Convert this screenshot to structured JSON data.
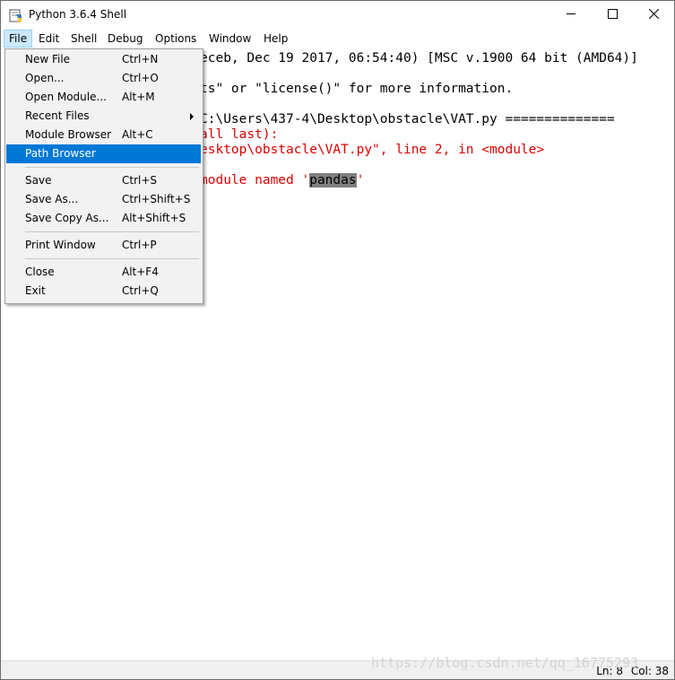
{
  "window": {
    "title": "Python 3.6.4 Shell"
  },
  "menubar": [
    {
      "label": "File"
    },
    {
      "label": "Edit"
    },
    {
      "label": "Shell"
    },
    {
      "label": "Debug"
    },
    {
      "label": "Options"
    },
    {
      "label": "Window"
    },
    {
      "label": "Help"
    }
  ],
  "shell": {
    "line1": "eceb, Dec 19 2017, 06:54:40) [MSC v.1900 64 bit (AMD64)]",
    "line2": "ts\" or \"license()\" for more information.",
    "line3": "C:\\Users\\437-4\\Desktop\\obstacle\\VAT.py ==============",
    "line4": "all last):",
    "line5": "esktop\\obstacle\\VAT.py\", line 2, in <module>",
    "line6_prefix": "module named '",
    "line6_selected": "pandas",
    "line6_suffix": "'"
  },
  "file_menu": {
    "new_file": {
      "label": "New File",
      "shortcut": "Ctrl+N"
    },
    "open": {
      "label": "Open...",
      "shortcut": "Ctrl+O"
    },
    "open_module": {
      "label": "Open Module...",
      "shortcut": "Alt+M"
    },
    "recent_files": {
      "label": "Recent Files"
    },
    "module_browser": {
      "label": "Module Browser",
      "shortcut": "Alt+C"
    },
    "path_browser": {
      "label": "Path Browser"
    },
    "save": {
      "label": "Save",
      "shortcut": "Ctrl+S"
    },
    "save_as": {
      "label": "Save As...",
      "shortcut": "Ctrl+Shift+S"
    },
    "save_copy_as": {
      "label": "Save Copy As...",
      "shortcut": "Alt+Shift+S"
    },
    "print_window": {
      "label": "Print Window",
      "shortcut": "Ctrl+P"
    },
    "close": {
      "label": "Close",
      "shortcut": "Alt+F4"
    },
    "exit": {
      "label": "Exit",
      "shortcut": "Ctrl+Q"
    }
  },
  "status": {
    "ln": "Ln: 8",
    "col": "Col: 38"
  },
  "watermark": "https://blog.csdn.net/qq_16775293",
  "colors": {
    "error_text": "#dd0000",
    "highlight": "#0078d7",
    "selection": "#808080"
  }
}
